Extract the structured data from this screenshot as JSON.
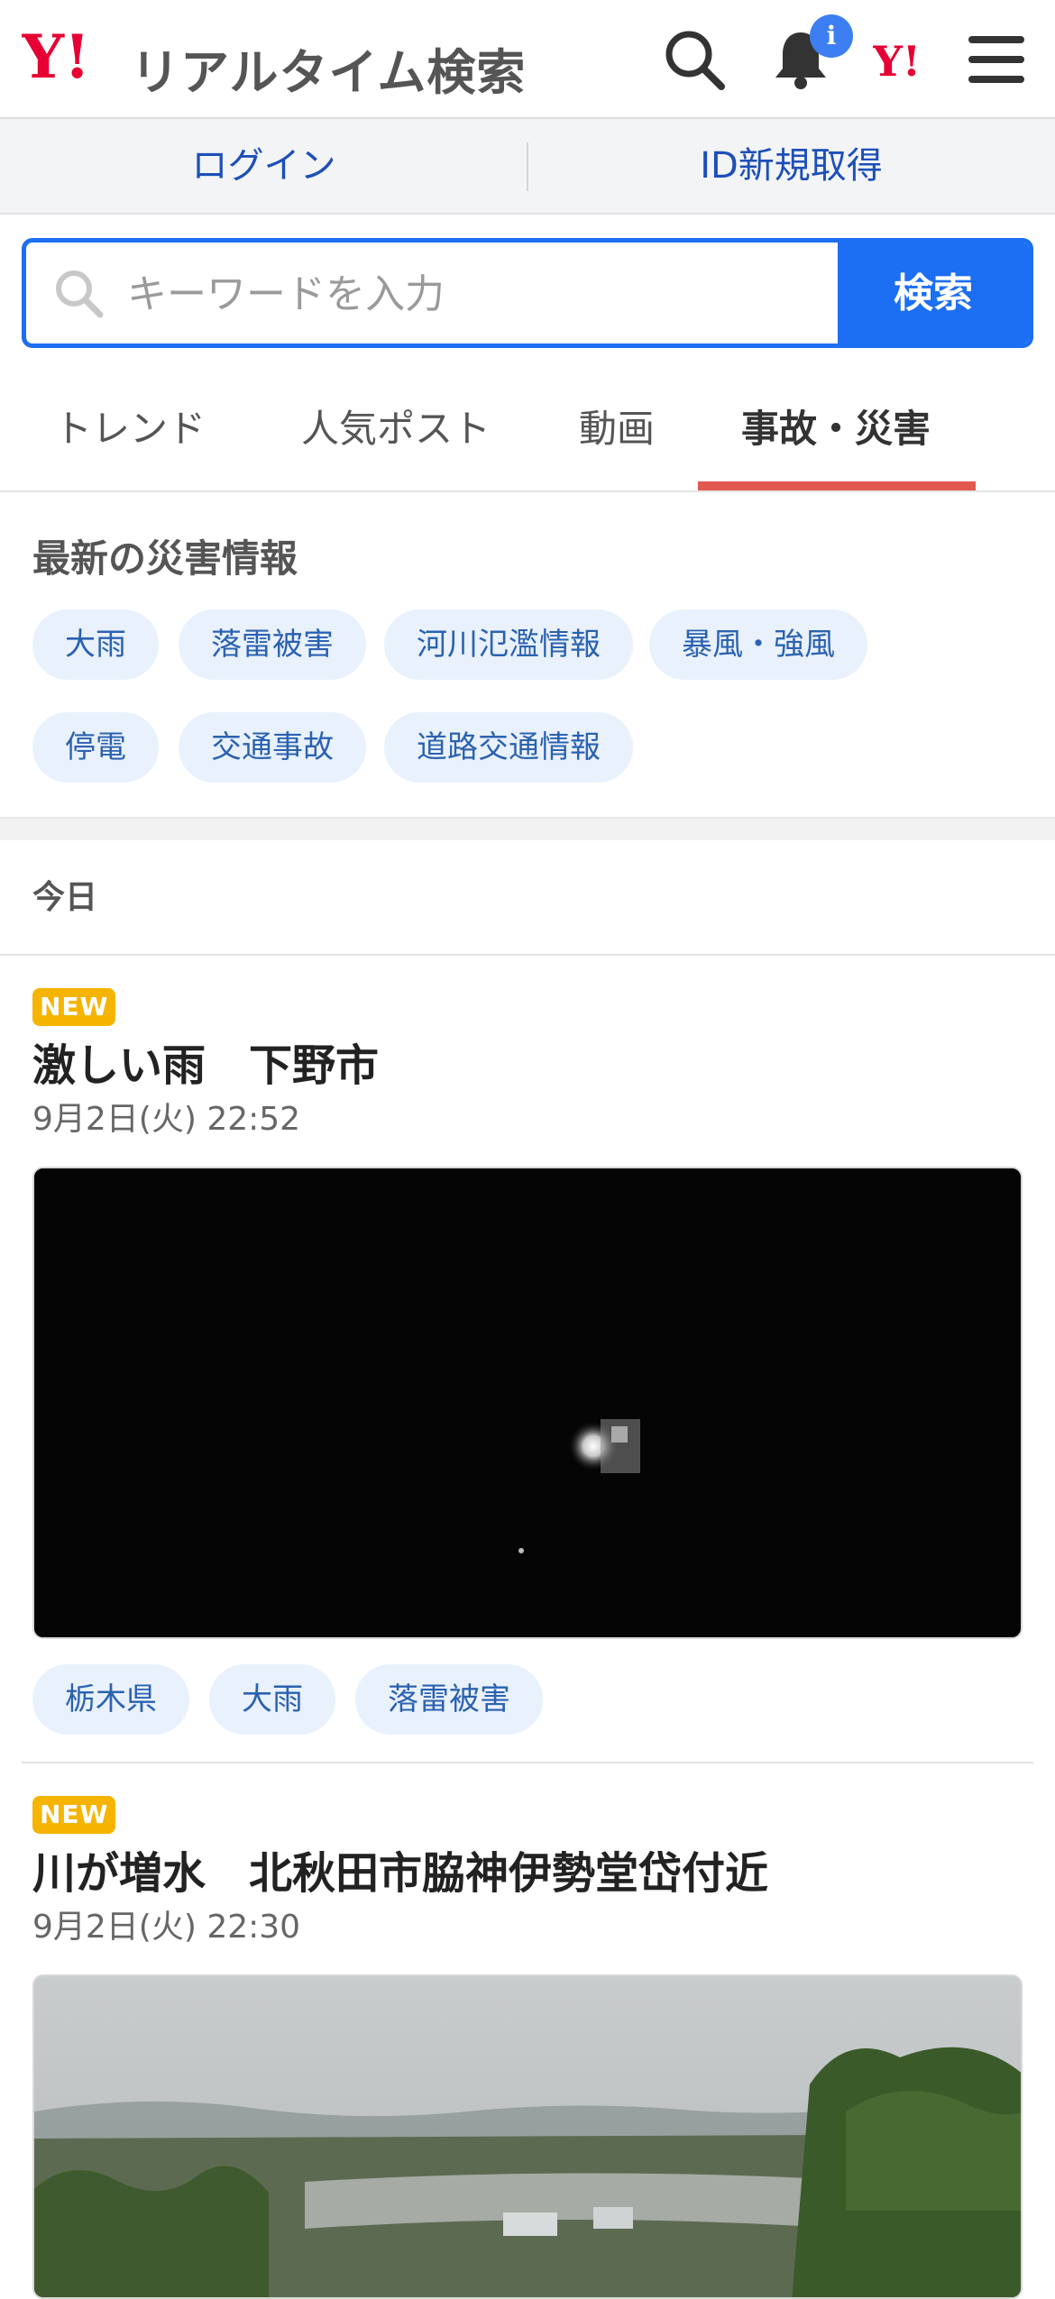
{
  "header": {
    "logo_mark": "Y!",
    "logo_text": "リアルタイム検索",
    "notification_badge": "i",
    "yahoo_link_mark": "Y!"
  },
  "auth": {
    "login": "ログイン",
    "signup": "ID新規取得"
  },
  "search": {
    "placeholder": "キーワードを入力",
    "value": "",
    "button": "検索"
  },
  "tabs": [
    {
      "label": "トレンド",
      "active": false
    },
    {
      "label": "人気ポスト",
      "active": false
    },
    {
      "label": "動画",
      "active": false
    },
    {
      "label": "事故・災害",
      "active": true
    }
  ],
  "disaster": {
    "title": "最新の災害情報",
    "chips": [
      "大雨",
      "落雷被害",
      "河川氾濫情報",
      "暴風・強風",
      "停電",
      "交通事故",
      "道路交通情報"
    ]
  },
  "day_label": "今日",
  "posts": [
    {
      "badge": "NEW",
      "title": "激しい雨　下野市",
      "time": "9月2日(火) 22:52",
      "media": "night-video-thumbnail",
      "tags": [
        "栃木県",
        "大雨",
        "落雷被害"
      ]
    },
    {
      "badge": "NEW",
      "title": "川が増水　北秋田市脇神伊勢堂岱付近",
      "time": "9月2日(火) 22:30",
      "media": "flooded-river-landscape-thumbnail",
      "tags": []
    }
  ],
  "colors": {
    "brand_red": "#e60033",
    "accent_blue": "#1c6ef2",
    "tab_underline": "#e0584f",
    "new_badge": "#f5b400",
    "chip_bg": "#e9f1fc",
    "chip_text": "#2b62b0"
  }
}
